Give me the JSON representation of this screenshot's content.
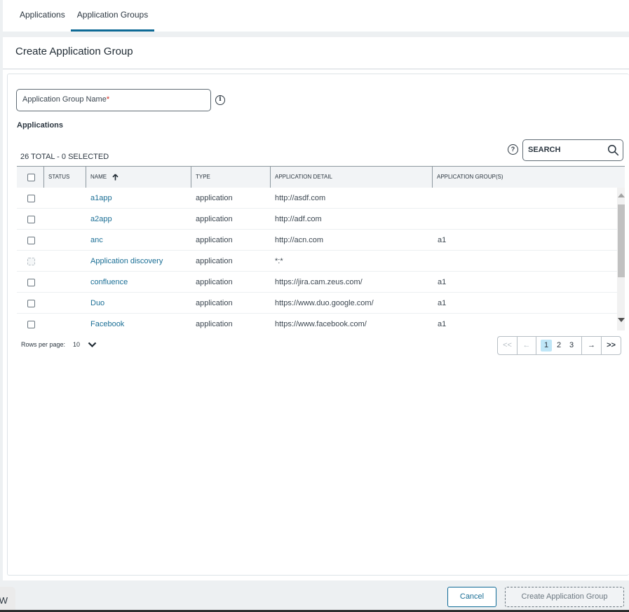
{
  "tabs": [
    {
      "label": "Applications",
      "active": false
    },
    {
      "label": "Application Groups",
      "active": true
    }
  ],
  "panel": {
    "title": "Create Application Group"
  },
  "form": {
    "group_name_placeholder": "Application Group Name",
    "required_marker": "*",
    "info_icon": "i",
    "applications_label": "Applications"
  },
  "table": {
    "summary": "26 TOTAL - 0 SELECTED",
    "help_icon": "?",
    "search_placeholder": "SEARCH",
    "columns": [
      "STATUS",
      "NAME",
      "TYPE",
      "APPLICATION DETAIL",
      "APPLICATION GROUP(S)"
    ],
    "sort": {
      "column": "NAME",
      "direction": "ascending"
    },
    "rows": [
      {
        "status": "",
        "name": "a1app",
        "type": "application",
        "detail": "http://asdf.com",
        "groups": "",
        "disabled": false
      },
      {
        "status": "",
        "name": "a2app",
        "type": "application",
        "detail": "http://adf.com",
        "groups": "",
        "disabled": false
      },
      {
        "status": "",
        "name": "anc",
        "type": "application",
        "detail": "http://acn.com",
        "groups": "a1",
        "disabled": false
      },
      {
        "status": "",
        "name": "Application discovery",
        "type": "application",
        "detail": "*:*",
        "groups": "",
        "disabled": true
      },
      {
        "status": "",
        "name": "confluence",
        "type": "application",
        "detail": "https://jira.cam.zeus.com/",
        "groups": "a1",
        "disabled": false
      },
      {
        "status": "",
        "name": "Duo",
        "type": "application",
        "detail": "https://www.duo.google.com/",
        "groups": "a1",
        "disabled": false
      },
      {
        "status": "",
        "name": "Facebook",
        "type": "application",
        "detail": "https://www.facebook.com/",
        "groups": "a1",
        "disabled": false
      }
    ]
  },
  "pagination": {
    "rows_per_page_label": "Rows per page:",
    "rows_per_page": "10",
    "first": "<<",
    "prev": "←",
    "next": "→",
    "last": ">>",
    "pages": [
      "1",
      "2",
      "3"
    ],
    "current_page": "1"
  },
  "footer": {
    "side_tab_label": "W",
    "cancel_label": "Cancel",
    "create_label": "Create Application Group"
  },
  "colors": {
    "accent": "#0e6a96",
    "link": "#1a6e95",
    "required": "#d0271d",
    "active_page": "#bfe6f7"
  }
}
